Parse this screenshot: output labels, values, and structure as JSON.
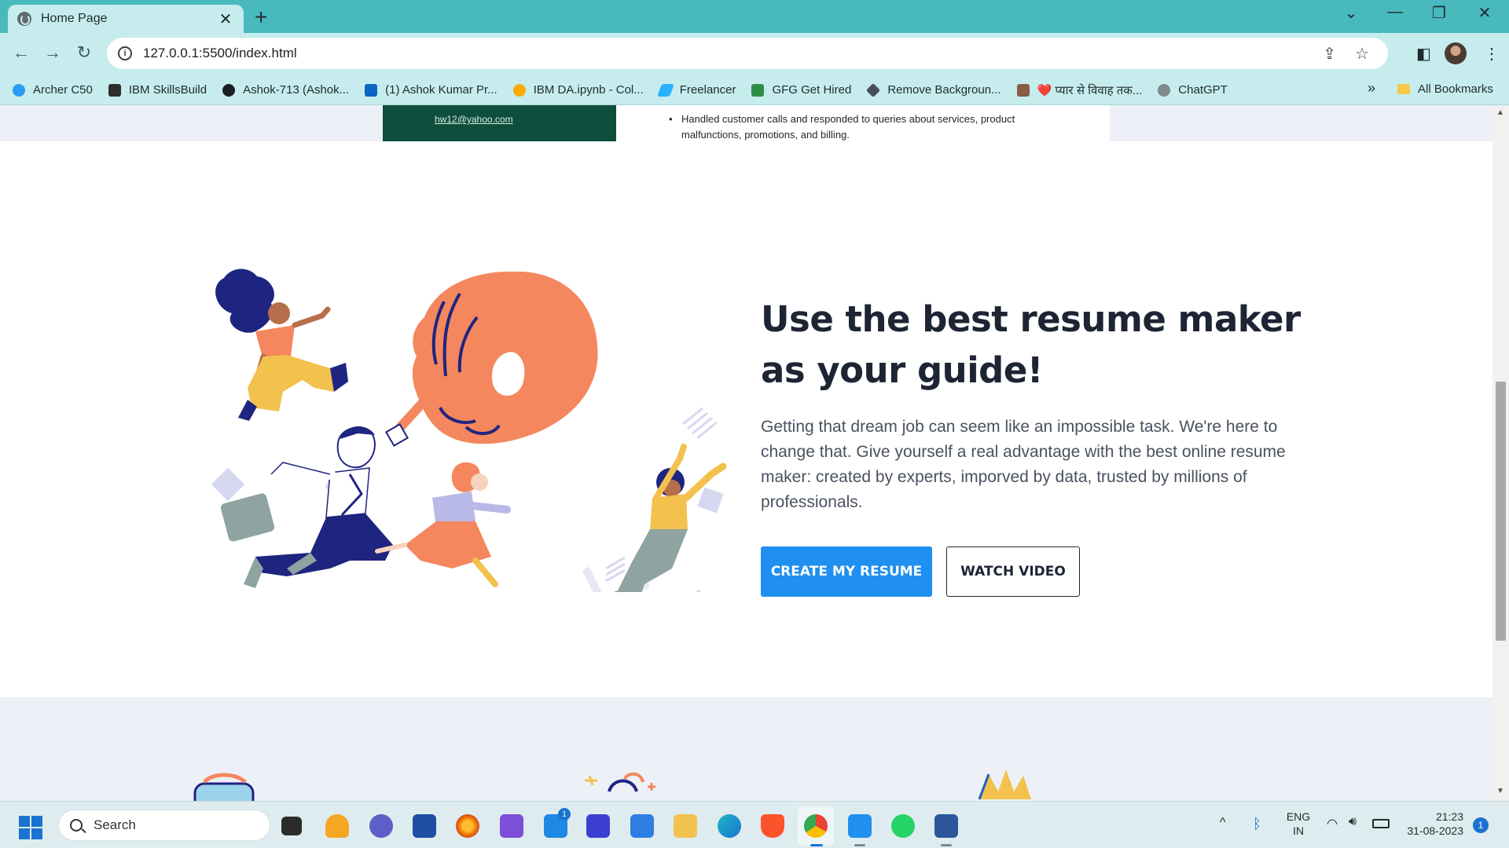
{
  "browser": {
    "tab_title": "Home Page",
    "tab_close": "✕",
    "new_tab": "+",
    "url": "127.0.0.1:5500/index.html",
    "bookmarks": [
      {
        "label": "Archer C50",
        "color": "#2a9df4"
      },
      {
        "label": "IBM SkillsBuild",
        "color": "#2d2d2d"
      },
      {
        "label": "Ashok-713 (Ashok...",
        "color": "#1b1f23"
      },
      {
        "label": "(1) Ashok Kumar Pr...",
        "color": "#0a66c2"
      },
      {
        "label": "IBM DA.ipynb - Col...",
        "color": "#f9ab00"
      },
      {
        "label": "Freelancer",
        "color": "#29b2fe"
      },
      {
        "label": "GFG Get Hired",
        "color": "#2f8d46"
      },
      {
        "label": "Remove Backgroun...",
        "color": "#454f5b"
      },
      {
        "label": "❤️ प्यार से विवाह तक...",
        "color": "#8a5a44"
      },
      {
        "label": "ChatGPT",
        "color": "#7f8a8c"
      }
    ],
    "bookmarks_more": "»",
    "all_bookmarks": "All Bookmarks"
  },
  "resume_preview": {
    "email": "hw12@yahoo.com",
    "bullet": "Handled customer calls and responded to queries about services, product malfunctions, promotions, and billing."
  },
  "hero": {
    "title": "Use the best resume maker as your guide!",
    "description": "Getting that dream job can seem like an impossible task. We're here to change that. Give yourself a real advantage with the best online resume maker: created by experts, imporved by data, trusted by millions of professionals.",
    "primary_button": "CREATE MY RESUME",
    "secondary_button": "WATCH VIDEO"
  },
  "taskbar": {
    "search_placeholder": "Search",
    "mail_badge": "1",
    "language": "ENG",
    "region": "IN",
    "time": "21:23",
    "date": "31-08-2023",
    "notification_count": "1"
  },
  "colors": {
    "accent_blue": "#1f8ff0",
    "chrome_teal": "#48b9bd",
    "illustration_orange": "#f4875e",
    "illustration_navy": "#1e2580"
  }
}
